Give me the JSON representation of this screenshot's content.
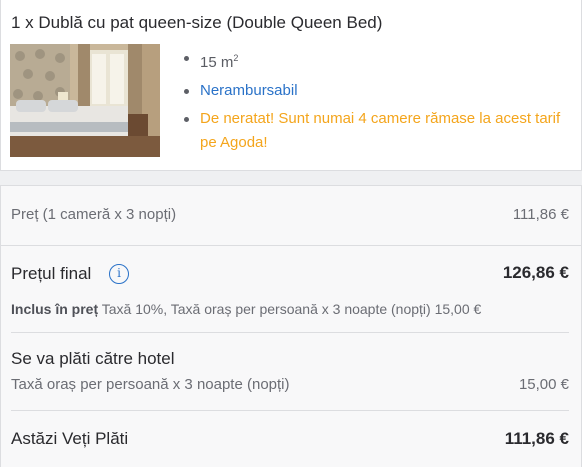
{
  "room": {
    "title": "1 x Dublă cu pat queen-size (Double Queen Bed)",
    "bullets": {
      "size": "15 m",
      "size_unit_sup": "2",
      "refund": "Nerambursabil",
      "warning": "De neratat! Sunt numai 4 camere rămase la acest tarif pe Agoda!"
    },
    "colors": {
      "link": "#2a72c8",
      "warning": "#f4a51c"
    }
  },
  "pricing": {
    "base_label": "Preț (1 cameră x 3 nopți)",
    "base_amount": "111,86 €",
    "final_label": "Prețul final",
    "info_icon": "i",
    "final_amount": "126,86 €",
    "included_label": "Inclus în preț",
    "included_text": " Taxă 10%, Taxă oraș per persoană x 3 noapte (nopți) 15,00 €",
    "hotel_title": "Se va plăti către hotel",
    "hotel_sub": "Taxă oraș per persoană x 3 noapte (nopți)",
    "hotel_amount": "15,00 €",
    "today_label": "Astăzi Veți Plăti",
    "today_amount": "111,86 €"
  }
}
